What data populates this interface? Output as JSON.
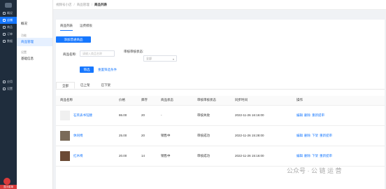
{
  "nav": {
    "items": [
      {
        "label": "概况",
        "icon": "overview-icon",
        "active": false
      },
      {
        "label": "店铺",
        "icon": "store-icon",
        "active": true
      },
      {
        "label": "商品",
        "icon": "goods-icon",
        "active": false
      },
      {
        "label": "订单",
        "icon": "order-icon",
        "active": false
      },
      {
        "label": "数据",
        "icon": "data-icon",
        "active": false
      }
    ],
    "lower_items": [
      {
        "label": "应用",
        "icon": "app-icon"
      },
      {
        "label": "设置",
        "icon": "settings-icon"
      }
    ],
    "bottom_label": "显示菜单"
  },
  "subnav": {
    "top_item": "概况",
    "group1": "功能",
    "item1": "商品管理",
    "group2": "设置",
    "item2": "基础信息"
  },
  "breadcrumb": {
    "shop": "视频号小店",
    "section": "商品管理",
    "current": "商品列表",
    "sep": "/"
  },
  "tabs": {
    "list": "商品列表",
    "audit": "运费模板"
  },
  "add_button": "添加普通商品",
  "filters": {
    "name_label": "商品名称:",
    "name_placeholder": "请输入商品名称",
    "status_label": "审核审核状态:",
    "status_value": "全部",
    "filter_button": "筛选",
    "reset_button": "重置筛选条件"
  },
  "status_tabs": [
    "全部",
    "已上架",
    "已下架"
  ],
  "table": {
    "headers": [
      "商品名称",
      "价格",
      "库存",
      "商品状态",
      "审核审核状态",
      "同步时间",
      "操作"
    ],
    "rows": [
      {
        "name": "石英表书馆腰",
        "price": "86.00",
        "stock": "20",
        "status": "-",
        "audit": "审核失败",
        "time": "2022-11-26 16:16:00",
        "ops": [
          "编辑",
          "删除",
          "重新提审"
        ]
      },
      {
        "name": "休闲椅",
        "price": "25.00",
        "stock": "20",
        "status": "销售中",
        "audit": "审核成功",
        "time": "2022-11-26 15:28:00",
        "ops": [
          "编辑",
          "删除",
          "下架",
          "重新提审"
        ]
      },
      {
        "name": "红木椅",
        "price": "20.00",
        "stock": "14",
        "status": "销售中",
        "audit": "审核成功",
        "time": "2022-11-26 15:16:00",
        "ops": [
          "编辑",
          "删除",
          "下架",
          "重新提审"
        ]
      }
    ]
  },
  "watermark": "公众号 · 公 链 运 营",
  "colors": {
    "accent": "#1677ff",
    "sidebar": "#1f2d3d"
  }
}
